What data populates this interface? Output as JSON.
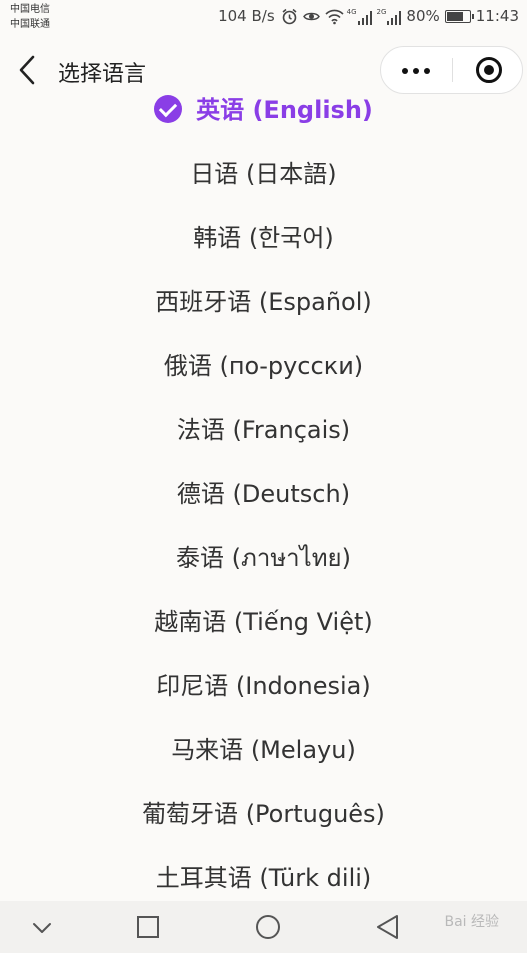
{
  "status_bar": {
    "carrier_1": "中国电信",
    "carrier_2": "中国联通",
    "speed": "104 B/s",
    "network_4g": "4G",
    "network_2g": "2G",
    "battery": "80%",
    "battery_level": 0.8,
    "time": "11:43"
  },
  "header": {
    "title": "选择语言"
  },
  "languages": [
    {
      "label": "英语 (English)",
      "selected": true
    },
    {
      "label": "日语 (日本語)"
    },
    {
      "label": "韩语 (한국어)"
    },
    {
      "label": "西班牙语 (Español)"
    },
    {
      "label": "俄语 (по-русски)"
    },
    {
      "label": "法语 (Français)"
    },
    {
      "label": "德语 (Deutsch)"
    },
    {
      "label": "泰语 (ภาษาไทย)"
    },
    {
      "label": "越南语 (Tiếng Việt)"
    },
    {
      "label": "印尼语 (Indonesia)"
    },
    {
      "label": "马来语 (Melayu)"
    },
    {
      "label": "葡萄牙语 (Português)"
    },
    {
      "label": "土耳其语 (Türk dili)"
    }
  ],
  "watermark": "Bai 经验",
  "colors": {
    "accent": "#8a3ee6",
    "text": "#333333",
    "background": "#fbfaf8"
  }
}
